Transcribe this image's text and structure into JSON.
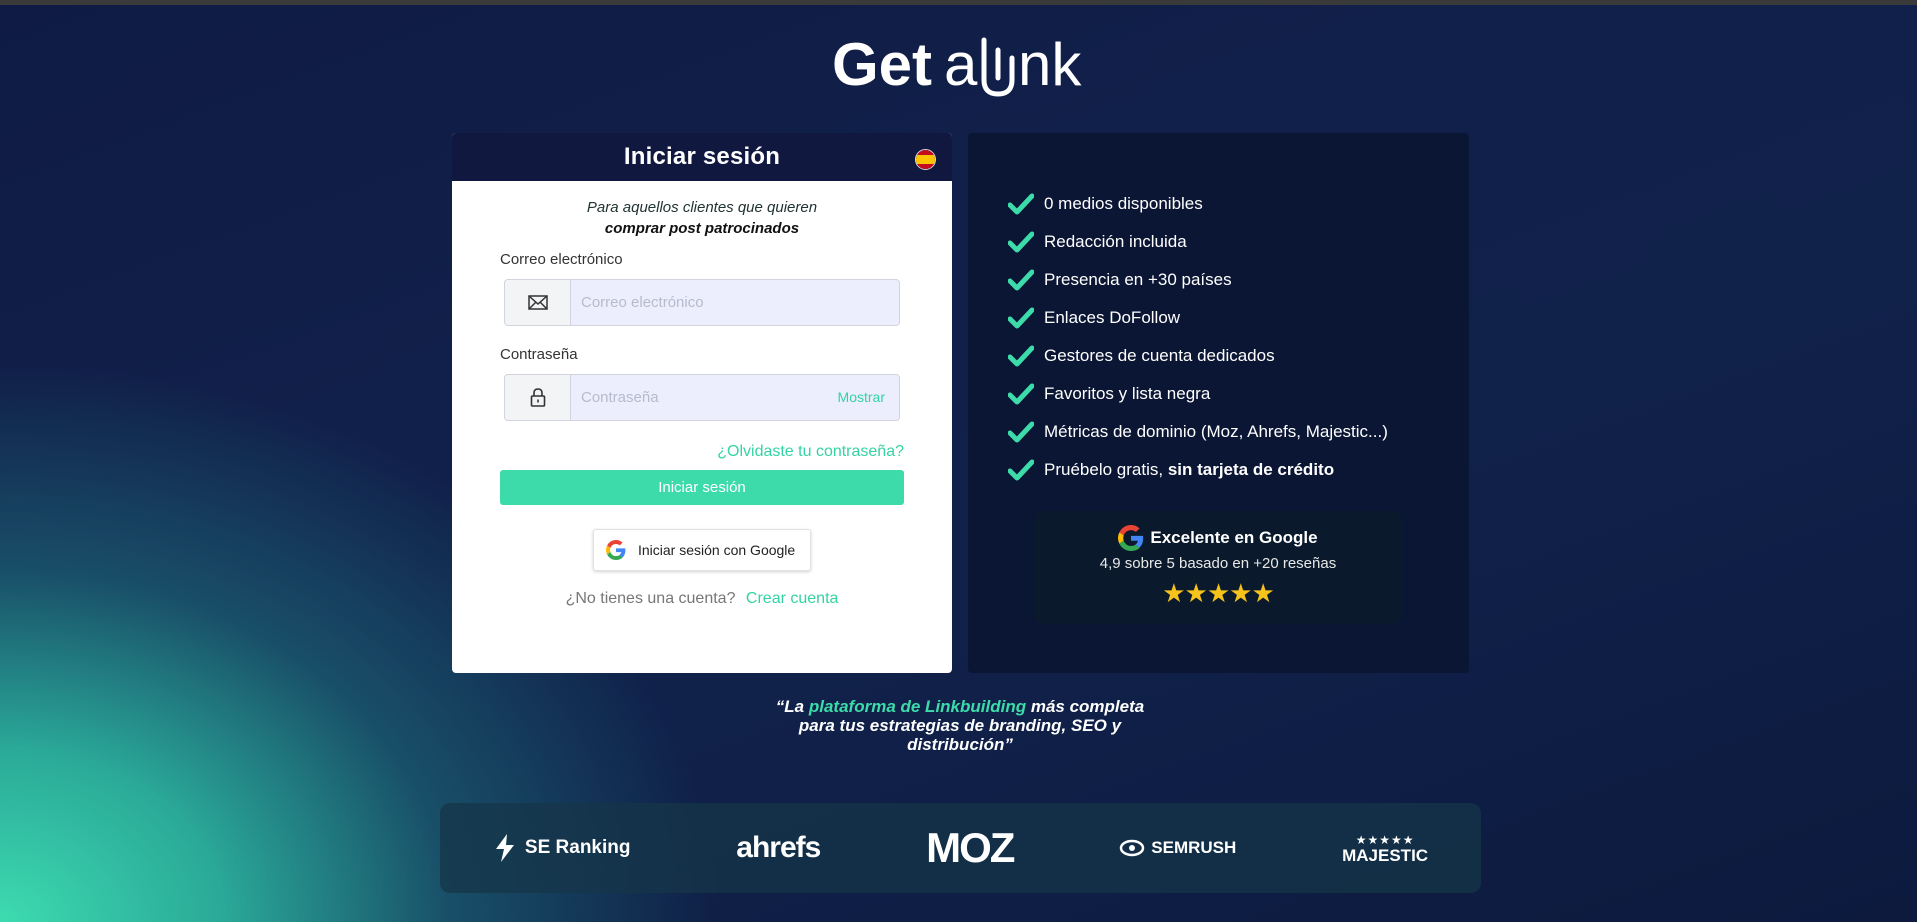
{
  "brand": {
    "logo_text": "Getalink"
  },
  "login": {
    "title": "Iniciar sesión",
    "intro_line1": "Para aquellos clientes que quieren",
    "intro_line2": "comprar post patrocinados",
    "email_label": "Correo electrónico",
    "email_placeholder": "Correo electrónico",
    "password_label": "Contraseña",
    "password_placeholder": "Contraseña",
    "show_password": "Mostrar",
    "forgot": "¿Olvidaste tu contraseña?",
    "submit": "Iniciar sesión",
    "google": "Iniciar sesión con Google",
    "no_account": "¿No tienes una cuenta?",
    "create_account": "Crear cuenta"
  },
  "features": {
    "items": [
      "0 medios disponibles",
      "Redacción incluida",
      "Presencia en +30 países",
      "Enlaces DoFollow",
      "Gestores de cuenta dedicados",
      "Favoritos y lista negra",
      "Métricas de dominio (Moz, Ahrefs, Majestic...)"
    ],
    "last_item_prefix": "Pruébelo gratis,",
    "last_item_bold": "sin tarjeta de crédito"
  },
  "review": {
    "title": "Excelente en Google",
    "subtitle": "4,9 sobre 5 basado en +20 reseñas",
    "stars": "★★★★★",
    "rating": 4.9
  },
  "tagline": {
    "open": "“La",
    "accent": "plataforma de Linkbuilding",
    "rest": "más completa para tus estrategias de branding, SEO y distribución”"
  },
  "partners": [
    "SE Ranking",
    "ahrefs",
    "MOZ",
    "SEMRUSH",
    "MAJESTIC"
  ],
  "colors": {
    "accent": "#3ddbaa",
    "navy": "#10183f",
    "star": "#f6c31c"
  }
}
